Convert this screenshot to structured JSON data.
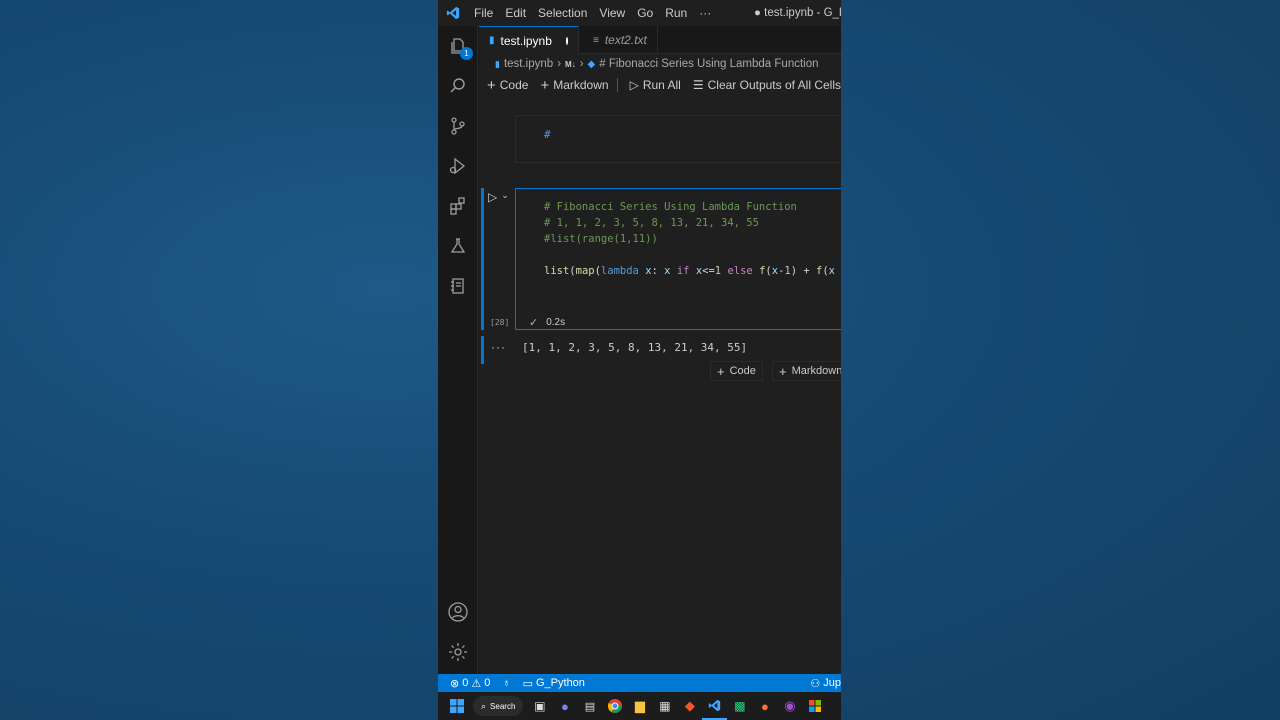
{
  "titlebar": {
    "menu": [
      "File",
      "Edit",
      "Selection",
      "View",
      "Go",
      "Run",
      "···"
    ],
    "title": "● test.ipynb - G_Pyt"
  },
  "activity": {
    "explorer_badge": "1"
  },
  "tabs": [
    {
      "label": "test.ipynb",
      "dirty": true
    },
    {
      "label": "text2.txt",
      "dirty": false
    }
  ],
  "breadcrumb": {
    "file": "test.ipynb",
    "md": "M↓",
    "heading": "# Fibonacci Series Using Lambda Function"
  },
  "toolbar": {
    "code": "Code",
    "markdown": "Markdown",
    "run_all": "Run All",
    "clear": "Clear Outputs of All Cells"
  },
  "cells": {
    "md_cell_text": "#",
    "code_lines": {
      "c1": "# Fibonacci Series Using Lambda Function",
      "c2": "# 1, 1, 2, 3, 5, 8, 13, 21, 34, 55",
      "c3": "#list(range(1,11))"
    },
    "exec_count": "[28]",
    "duration": "0.2s",
    "output": "[1, 1, 2, 3, 5, 8, 13, 21, 34, 55]",
    "add_code": "Code",
    "add_markdown": "Markdown"
  },
  "statusbar": {
    "errors": "0",
    "warnings": "0",
    "folder": "G_Python",
    "right": "Jup"
  },
  "taskbar": {
    "search": "Search"
  },
  "colors": {
    "accent": "#0078d4",
    "background": "#164a73"
  }
}
